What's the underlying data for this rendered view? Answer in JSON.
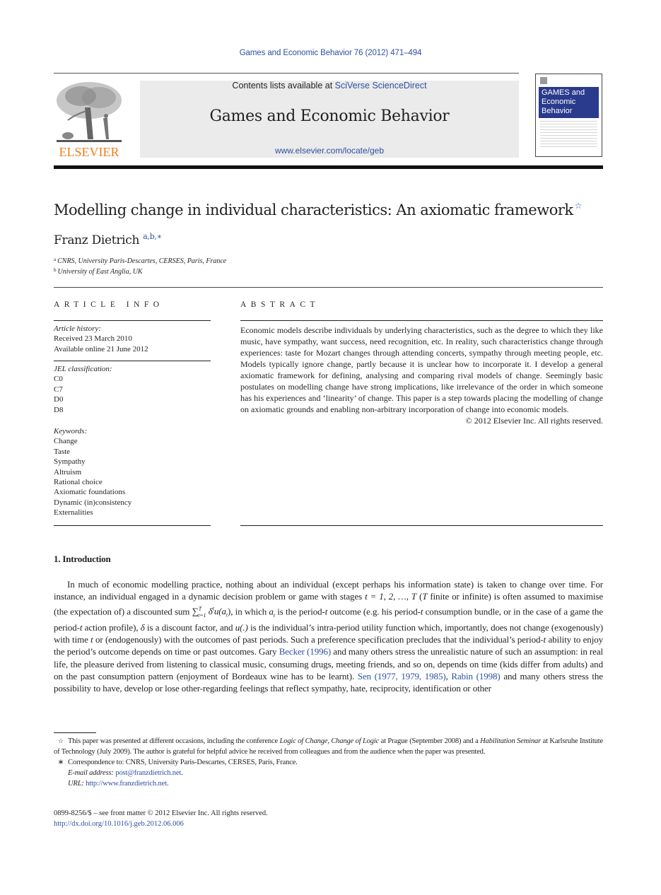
{
  "header": {
    "citation": "Games and Economic Behavior 76 (2012) 471–494",
    "publisher_logo_text": "ELSEVIER",
    "contents_prefix": "Contents lists available at ",
    "contents_link": "SciVerse ScienceDirect",
    "journal_title": "Games and Economic Behavior",
    "journal_url": "www.elsevier.com/locate/geb",
    "cover_title_lines": [
      "GAMES and",
      "Economic",
      "Behavior"
    ]
  },
  "article": {
    "title": "Modelling change in individual characteristics: An axiomatic framework",
    "title_note_mark": "☆",
    "author": "Franz Dietrich",
    "author_marks": "a,b,∗",
    "affiliations": [
      {
        "mark": "a",
        "text": "CNRS, University Paris-Descartes, CERSES, Paris, France"
      },
      {
        "mark": "b",
        "text": "University of East Anglia, UK"
      }
    ]
  },
  "article_info": {
    "heading": "ARTICLE INFO",
    "history_label": "Article history:",
    "received": "Received 23 March 2010",
    "available": "Available online 21 June 2012",
    "jel_label": "JEL classification:",
    "jel_codes": [
      "C0",
      "C7",
      "D0",
      "D8"
    ],
    "keywords_label": "Keywords:",
    "keywords": [
      "Change",
      "Taste",
      "Sympathy",
      "Altruism",
      "Rational choice",
      "Axiomatic foundations",
      "Dynamic (in)consistency",
      "Externalities"
    ]
  },
  "abstract": {
    "heading": "ABSTRACT",
    "text": "Economic models describe individuals by underlying characteristics, such as the degree to which they like music, have sympathy, want success, need recognition, etc. In reality, such characteristics change through experiences: taste for Mozart changes through attending concerts, sympathy through meeting people, etc. Models typically ignore change, partly because it is unclear how to incorporate it. I develop a general axiomatic framework for defining, analysing and comparing rival models of change. Seemingly basic postulates on modelling change have strong implications, like irrelevance of the order in which someone has his experiences and ‘linearity’ of change. This paper is a step towards placing the modelling of change on axiomatic grounds and enabling non-arbitrary incorporation of change into economic models.",
    "copyright": "© 2012 Elsevier Inc. All rights reserved."
  },
  "introduction": {
    "heading": "1. Introduction",
    "p1_a": "In much of economic modelling practice, nothing about an individual (except perhaps his information state) is taken to change over time. For instance, an individual engaged in a dynamic decision problem or game with stages ",
    "p1_stages": "t = 1, 2, …, T",
    "p1_b": " (",
    "p1_T": "T",
    "p1_c": " finite or infinite) is often assumed to maximise (the expectation of) a discounted sum ",
    "p1_sum": "∑",
    "p1_sum_sup": "T",
    "p1_sum_sub": "t=1",
    "p1_sum_rest": " δ",
    "p1_sum_t": "t",
    "p1_u": "u(a",
    "p1_u_sub": "t",
    "p1_u_close": ")",
    "p1_d": ", in which ",
    "p1_at": "a",
    "p1_at_sub": "t",
    "p1_e": " is the period-",
    "p1_t1": "t",
    "p1_f": " outcome (e.g. his period-",
    "p1_t2": "t",
    "p1_g": " consumption bundle, or in the case of a game the period-",
    "p1_t3": "t",
    "p1_h": " action profile), ",
    "p1_delta": "δ",
    "p1_i": " is a discount factor, and ",
    "p1_u2": "u(.)",
    "p1_j": " is the individual’s intra-period utility function which, importantly, does not change (exogenously) with time ",
    "p1_t4": "t",
    "p1_k": " or (endogenously) with the outcomes of past periods. Such a preference specification precludes that the individual’s period-",
    "p1_t5": "t",
    "p1_l": " ability to enjoy the period’s outcome depends on time or past outcomes. Gary ",
    "ref_becker": "Becker (1996)",
    "p1_m": " and many others stress the unrealistic nature of such an assumption: in real life, the pleasure derived from listening to classical music, consuming drugs, meeting friends, and so on, depends on time (kids differ from adults) and on the past consumption pattern (enjoyment of Bordeaux wine has to be learnt). ",
    "ref_sen": "Sen (1977, 1979, 1985)",
    "p1_n": ", ",
    "ref_rabin": "Rabin (1998)",
    "p1_o": " and many others stress the possibility to have, develop or lose other-regarding feelings that reflect sympathy, hate, reciprocity, identification or other"
  },
  "footnotes": {
    "star_mark": "☆",
    "star_a": "This paper was presented at different occasions, including the conference ",
    "star_conf": "Logic of Change, Change of Logic",
    "star_b": " at Prague (September 2008) and a ",
    "star_seminar": "Habilitation Seminar",
    "star_c": " at Karlsruhe Institute of Technology (July 2009). The author is grateful for helpful advice he received from colleagues and from the audience when the paper was presented.",
    "corr_mark": "∗",
    "corr_text": "Correspondence to: CNRS, University Paris-Descartes, CERSES, Paris, France.",
    "email_label": "E-mail address:",
    "email": "post@franzdietrich.net",
    "url_label": "URL:",
    "url": "http://www.franzdietrich.net"
  },
  "bottom": {
    "issn_line": "0899-8256/$ – see front matter  © 2012 Elsevier Inc. All rights reserved.",
    "doi": "http://dx.doi.org/10.1016/j.geb.2012.06.006"
  }
}
